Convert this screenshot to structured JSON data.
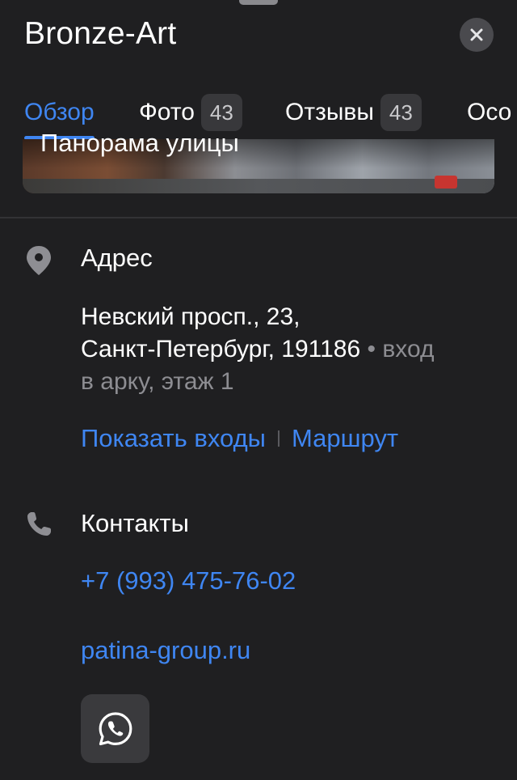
{
  "header": {
    "title": "Bronze-Art"
  },
  "tabs": [
    {
      "label": "Обзор",
      "count": null,
      "active": true
    },
    {
      "label": "Фото",
      "count": "43",
      "active": false
    },
    {
      "label": "Отзывы",
      "count": "43",
      "active": false
    },
    {
      "label": "Осо",
      "count": null,
      "active": false
    }
  ],
  "panorama": {
    "label": "Панорама улицы"
  },
  "address": {
    "heading": "Адрес",
    "line1": "Невский просп., 23,",
    "line2": "Санкт-Петербург, 191186",
    "bullet": " • ",
    "note_part1": "вход",
    "note_part2": "в арку, этаж 1",
    "show_entrances": "Показать входы",
    "route": "Маршрут"
  },
  "contacts": {
    "heading": "Контакты",
    "phone": "+7 (993) 475-76-02",
    "website": "patina-group.ru",
    "messenger_icon": "whatsapp-icon"
  },
  "colors": {
    "background": "#1f1f21",
    "accent": "#3f86f2",
    "muted_text": "#8d8d92",
    "badge_bg": "#38383b"
  }
}
